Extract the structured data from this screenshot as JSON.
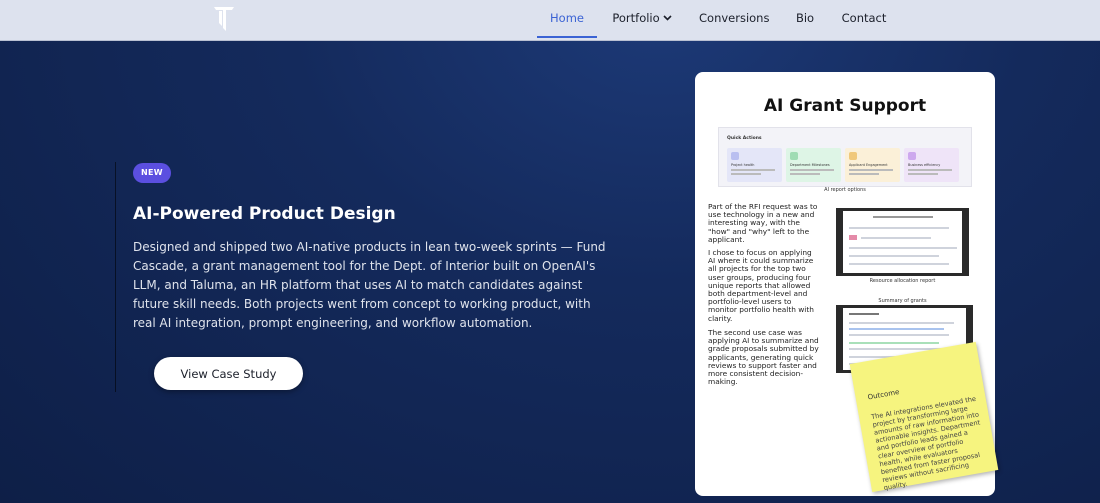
{
  "nav": {
    "items": [
      {
        "label": "Home",
        "active": true
      },
      {
        "label": "Portfolio",
        "has_dropdown": true
      },
      {
        "label": "Conversions"
      },
      {
        "label": "Bio"
      },
      {
        "label": "Contact"
      }
    ]
  },
  "hero": {
    "badge": "NEW",
    "title": "AI-Powered Product Design",
    "description": "Designed and shipped two AI-native products in lean two-week sprints — Fund Cascade, a grant management tool for the Dept. of Interior built on OpenAI's LLM, and Taluma, an HR platform that uses AI to match candidates against future skill needs. Both projects went from concept to working product, with real AI integration, prompt engineering, and workflow automation.",
    "cta_label": "View Case Study"
  },
  "card": {
    "title": "AI Grant Support",
    "quick_actions": {
      "heading": "Quick Actions",
      "tiles": [
        "Project health",
        "Department Milestones",
        "Applicant Engagement",
        "Business efficiency"
      ],
      "tile_colors": [
        "#e4e6f8",
        "#def5e6",
        "#fbf0d8",
        "#efe4f8"
      ],
      "icon_colors": [
        "#b9bff0",
        "#9fdcb3",
        "#f0c87a",
        "#cda8ee"
      ]
    },
    "caption_options": "AI report options",
    "paragraph_1": "Part of the RFI request was to use technology in a new and interesting way, with the \"how\" and \"why\" left to the applicant.",
    "paragraph_2": "I chose to focus on applying AI where it could summarize all projects for the top two user groups, producing four unique reports that allowed both department-level and portfolio-level users to monitor portfolio health with clarity.",
    "paragraph_3": "The second use case was applying AI to summarize and grade proposals submitted by applicants, generating quick reviews to support faster and more consistent decision-making.",
    "caption_resource": "Resource allocation report",
    "caption_summary": "Summary of grants",
    "note": {
      "heading": "Outcome",
      "body": "The AI integrations elevated the project  by transforming large amounts of raw information into actionable insights. Department and portfolio leads gained a clear overview of portfolio health, while evaluators benefited from faster proposal reviews without sacrificing quality."
    }
  },
  "colors": {
    "accent": "#3b63d4",
    "badge": "#5b4fe0",
    "note": "#f6f47f"
  }
}
